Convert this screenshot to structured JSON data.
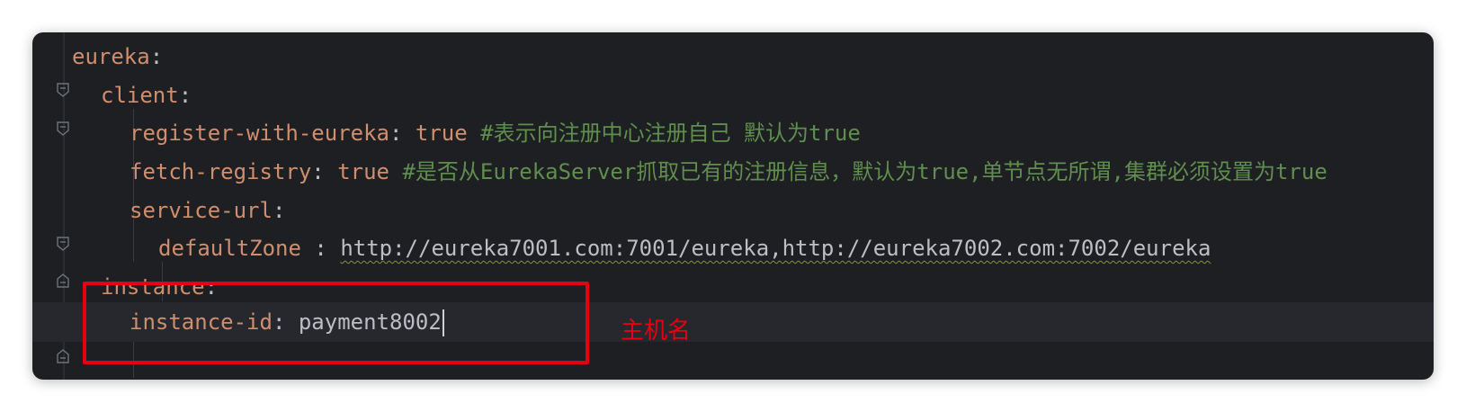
{
  "editor": {
    "lines": [
      {
        "key": "eureka",
        "colon": ":"
      },
      {
        "key": "client",
        "colon": ":"
      },
      {
        "key": "register-with-eureka",
        "colon": ":",
        "value": "true",
        "comment": "#表示向注册中心注册自己 默认为true"
      },
      {
        "key": "fetch-registry",
        "colon": ":",
        "value": "true",
        "comment": "#是否从EurekaServer抓取已有的注册信息，默认为true,单节点无所谓,集群必须设置为true"
      },
      {
        "key": "service-url",
        "colon": ":"
      },
      {
        "key": "defaultZone",
        "colon": " : ",
        "value": "http://eureka7001.com:7001/eureka,http://eureka7002.com:7002/eureka"
      },
      {
        "key": "instance",
        "colon": ":"
      },
      {
        "key": "instance-id",
        "colon": ": ",
        "value": "payment8002"
      }
    ]
  },
  "annotation": {
    "text": "主机名",
    "color": "#e60012"
  },
  "colors": {
    "background": "#1e1f22",
    "key": "#cf8e6d",
    "comment": "#5f8e4e",
    "text": "#bcbec4",
    "highlight": "#e60012"
  }
}
